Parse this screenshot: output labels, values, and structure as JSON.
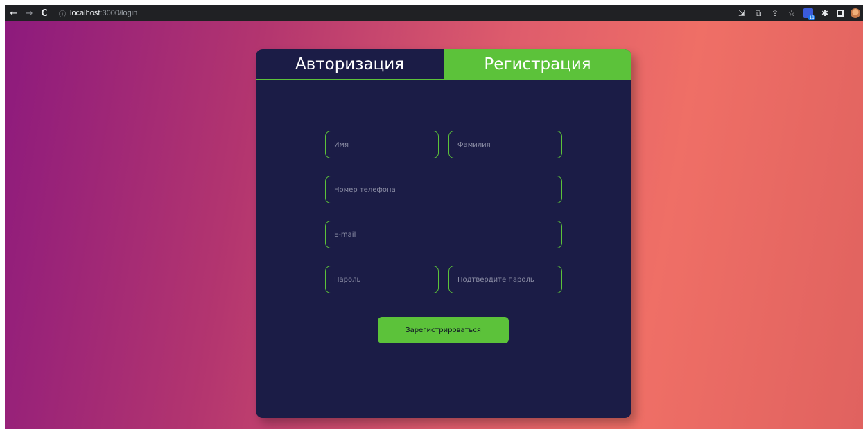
{
  "browser": {
    "nav": {
      "back_glyph": "←",
      "forward_glyph": "→",
      "reload_glyph": "C"
    },
    "address": {
      "host": "localhost",
      "path": ":3000/login",
      "info_icon": "info-icon"
    },
    "extensions": {
      "badge_count": "11"
    }
  },
  "auth": {
    "tabs": [
      {
        "label": "Авторизация",
        "active": false
      },
      {
        "label": "Регистрация",
        "active": true
      }
    ],
    "fields": {
      "first_name": {
        "placeholder": "Имя"
      },
      "last_name": {
        "placeholder": "Фамилия"
      },
      "phone": {
        "placeholder": "Номер телефона"
      },
      "email": {
        "placeholder": "E-mail"
      },
      "password": {
        "placeholder": "Пароль"
      },
      "confirm_password": {
        "placeholder": "Подтвердите пароль"
      }
    },
    "submit_label": "Зарегистрироваться"
  },
  "colors": {
    "accent": "#5cc23a",
    "card": "#1b1c46",
    "gradient_start": "#8d1a7d",
    "gradient_end": "#ef6f66"
  }
}
